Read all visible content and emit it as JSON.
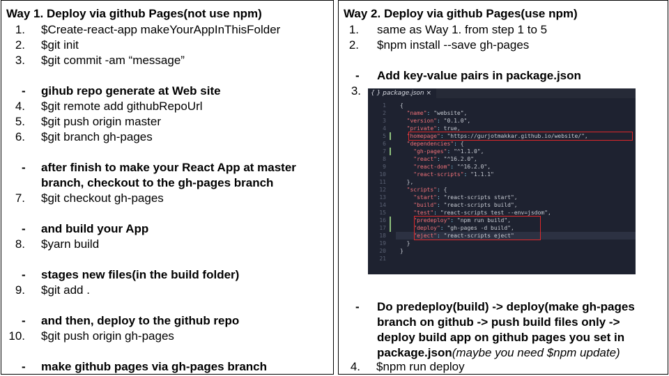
{
  "way1": {
    "title": "Way 1. Deploy via github Pages(not use npm)",
    "steps": [
      {
        "num": "1.",
        "text": "$Create-react-app makeYourAppInThisFolder"
      },
      {
        "num": "2.",
        "text": "$git init"
      },
      {
        "num": "3.",
        "text": "$git commit -am “message”"
      },
      {
        "num": "-",
        "text": "gihub repo generate at Web site"
      },
      {
        "num": "4.",
        "text": "$git remote add githubRepoUrl"
      },
      {
        "num": "5.",
        "text": "$git push origin master"
      },
      {
        "num": "6.",
        "text": "$git branch gh-pages"
      },
      {
        "num": "-",
        "text": "after finish to make your React App at master"
      },
      {
        "num": "",
        "text": "branch, checkout to the gh-pages branch"
      },
      {
        "num": "7.",
        "text": "$git checkout gh-pages"
      },
      {
        "num": "-",
        "text": "and build your App"
      },
      {
        "num": "8.",
        "text": "$yarn build"
      },
      {
        "num": "-",
        "text": "stages new files(in the build folder)"
      },
      {
        "num": "9.",
        "text": "$git add ."
      },
      {
        "num": "-",
        "text": "and then, deploy to the github repo"
      },
      {
        "num": "10.",
        "text": "$git push origin gh-pages"
      },
      {
        "num": "-",
        "text": "make github pages via gh-pages branch"
      }
    ]
  },
  "way2": {
    "title": "Way 2. Deploy via github Pages(use npm)",
    "steps": [
      {
        "num": "1.",
        "text": "same as Way 1. from step 1 to 5"
      },
      {
        "num": "2.",
        "text": "$npm install --save gh-pages"
      },
      {
        "num": "-",
        "text": "Add key-value pairs in package.json"
      },
      {
        "num": "3.",
        "text": ""
      },
      {
        "num": "-",
        "text": "Do predeploy(build) -> deploy(make gh-pages"
      },
      {
        "num": "",
        "text": "branch on github -> push build files only ->"
      },
      {
        "num": "",
        "text": "deploy build app on github pages you set in"
      },
      {
        "num": "",
        "text": "package.json"
      },
      {
        "num": "",
        "text": "(maybe you need $npm update)"
      },
      {
        "num": "4.",
        "text": "$npm run deploy"
      }
    ]
  },
  "code": {
    "tab_label": "{ } package.json ×",
    "line_numbers": [
      "1",
      "2",
      "3",
      "4",
      "5",
      "6",
      "7",
      "8",
      "9",
      "10",
      "11",
      "12",
      "13",
      "14",
      "15",
      "16",
      "17",
      "18",
      "19",
      "20",
      "21"
    ],
    "lines": [
      "{",
      "  \"name\": \"website\",",
      "  \"version\": \"0.1.0\",",
      "  \"private\": true,",
      "  \"homepage\": \"https://gurjotmakkar.github.io/website/\",",
      "  \"dependencies\": {",
      "    \"gh-pages\": \"^1.1.0\",",
      "    \"react\": \"^16.2.0\",",
      "    \"react-dom\": \"^16.2.0\",",
      "    \"react-scripts\": \"1.1.1\"",
      "  },",
      "  \"scripts\": {",
      "    \"start\": \"react-scripts start\",",
      "    \"build\": \"react-scripts build\",",
      "    \"test\": \"react-scripts test --env=jsdom\",",
      "    \"predeploy\": \"npm run build\",",
      "    \"deploy\": \"gh-pages -d build\",",
      "    \"eject\": \"react-scripts eject\"",
      "  }",
      "}",
      ""
    ],
    "colors": {
      "background": "#1e2230",
      "key": "#f07178",
      "string": "#c3e88d",
      "highlight_box": "#e0282a"
    }
  }
}
